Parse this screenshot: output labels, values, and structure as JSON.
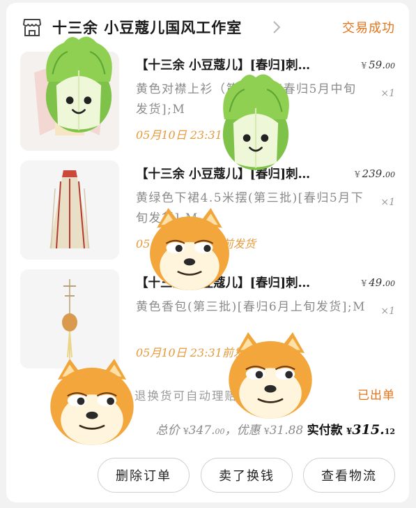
{
  "shop": {
    "name": "十三余 小豆蔻儿国风工作室",
    "icon": "shop-icon"
  },
  "order_status": "交易成功",
  "items": [
    {
      "title": "【十三余 小豆蔻儿】[春归]刺…",
      "price_symbol": "¥",
      "price_int": "59.",
      "price_dec": "00",
      "spec": "黄色对襟上衫（第三批）[春归5月中旬发货];M",
      "qty": "×1",
      "time": "05月10日 23:31前发货"
    },
    {
      "title": "【十三余 小豆蔻儿】[春归]刺…",
      "price_symbol": "¥",
      "price_int": "239.",
      "price_dec": "00",
      "spec": "黄绿色下裙4.5米摆(第三批)[春归5月下旬发货];M",
      "qty": "×1",
      "time": "05月10日 23:31前发货"
    },
    {
      "title": "【十三余 小豆蔻儿】[春归]刺…",
      "price_symbol": "¥",
      "price_int": "49.",
      "price_dec": "00",
      "spec": "黄色香包(第三批)[春归6月上旬发货];M",
      "qty": "×1",
      "time": "05月10日 23:31前发货"
    }
  ],
  "note": "退换货可自动理赔",
  "shipped_status": "已出单",
  "totals": {
    "total_label": "总价",
    "total_symbol": "¥",
    "total_int": "347.",
    "total_dec": "00",
    "sep": "，",
    "discount_label": "优惠",
    "discount_symbol": "¥",
    "discount_value": "31.88",
    "paid_label": "实付款",
    "paid_symbol": "¥",
    "paid_int": "315.",
    "paid_dec": "12"
  },
  "buttons": {
    "delete": "删除订单",
    "resell": "卖了换钱",
    "logistics": "查看物流"
  },
  "colors": {
    "accent": "#e4741a",
    "time": "#e59a3c"
  },
  "stickers": [
    "cabbage-sticker",
    "cabbage-sticker",
    "doge-sticker",
    "doge-sticker",
    "doge-sticker"
  ]
}
